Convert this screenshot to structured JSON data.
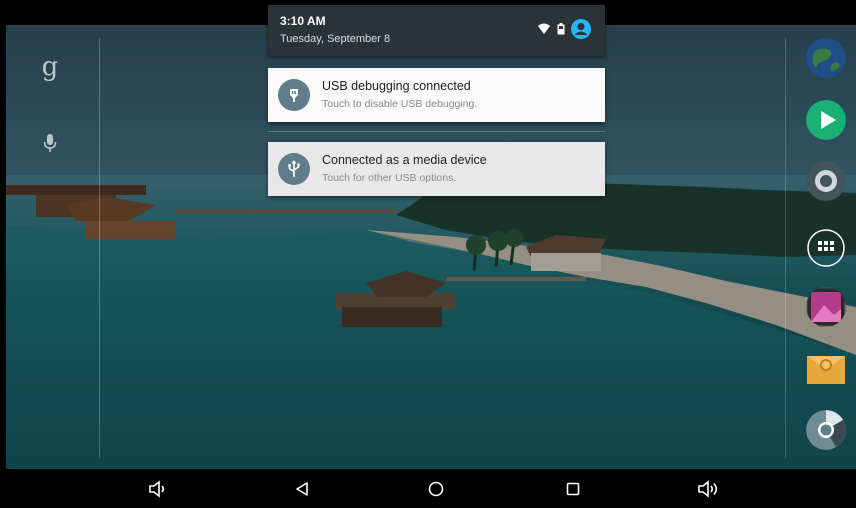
{
  "status_bar": {
    "time": "3:10 AM",
    "date": "Tuesday, September 8",
    "icons": [
      "wifi-icon",
      "battery-icon",
      "user-icon"
    ]
  },
  "notifications": [
    {
      "icon": "usb-debug-icon",
      "title": "USB debugging connected",
      "subtitle": "Touch to disable USB debugging."
    },
    {
      "icon": "usb-icon",
      "title": "Connected as a media device",
      "subtitle": "Touch for other USB options."
    }
  ],
  "home_screen": {
    "search_letter": "g",
    "search_icons": [
      "google-search-icon",
      "mic-icon"
    ],
    "dock_apps": [
      "globe-icon",
      "play-store-icon",
      "camera-icon",
      "apps-drawer-icon",
      "gallery-icon",
      "email-icon",
      "chrome-icon"
    ]
  },
  "navigation_bar": {
    "buttons": [
      "volume-down-icon",
      "back-icon",
      "home-icon",
      "recents-icon",
      "volume-up-icon"
    ]
  },
  "colors": {
    "accent": "#29b6f6",
    "shade_header": "#2b3336",
    "notification_icon_bg": "#607d8b",
    "play_green": "#1ab074",
    "email_yellow": "#e7a73a"
  }
}
